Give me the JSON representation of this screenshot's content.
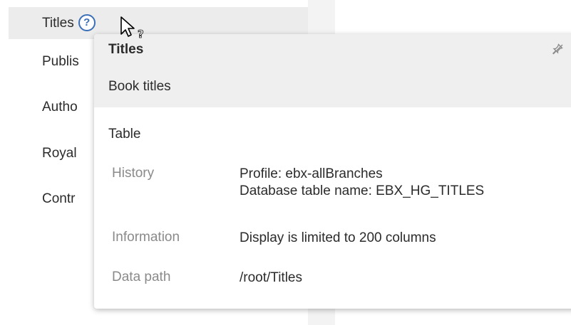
{
  "nav": {
    "items": [
      {
        "label": "Titles",
        "selected": true
      },
      {
        "label": "Publis"
      },
      {
        "label": "Autho"
      },
      {
        "label": "Royal"
      },
      {
        "label": "Contr"
      }
    ],
    "help_icon_glyph": "?"
  },
  "popover": {
    "title": "Titles",
    "description": "Book titles",
    "type": "Table",
    "properties": [
      {
        "label": "History",
        "value_line1": "Profile: ebx-allBranches",
        "value_line2": "Database table name: EBX_HG_TITLES"
      },
      {
        "label": "Information",
        "value_line1": "Display is limited to 200 columns"
      },
      {
        "label": "Data path",
        "value_line1": "/root/Titles"
      }
    ]
  },
  "cursor": {
    "type": "help-cursor"
  },
  "colors": {
    "selected_bg": "#ececec",
    "header_bg": "#efefef",
    "label_gray": "#8a8a8a",
    "help_icon_blue": "#3b6fb6"
  }
}
